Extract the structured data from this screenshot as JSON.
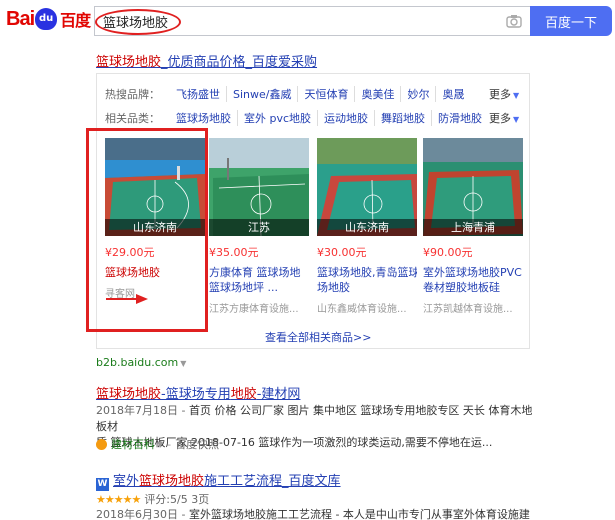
{
  "header": {
    "logo_bai": "Bai",
    "logo_du": "du",
    "logo_cn": "百度",
    "search_value": "篮球场地胶",
    "camera_icon": "camera-icon",
    "search_button": "百度一下",
    "brand_color": "#4e6ef2"
  },
  "ad": {
    "title_hl": "篮球场地胶",
    "title_rest": "_优质商品价格_百度爱采购",
    "brands_label": "热搜品牌：",
    "brands": [
      "飞扬盛世",
      "Sinwe/鑫威",
      "天恒体育",
      "奥美佳",
      "妙尔",
      "奥晟"
    ],
    "related_label": "相关品类：",
    "related": [
      "篮球场地胶",
      "室外 pvc地胶",
      "运动地胶",
      "舞蹈地胶",
      "防滑地胶"
    ],
    "more_label": "更多",
    "products": [
      {
        "location": "山东济南",
        "price": "¥29.00元",
        "name_line1_hl": "篮球场地胶",
        "name_line1_rest": "",
        "name_line2": "",
        "seller": "寻客网"
      },
      {
        "location": "江苏",
        "price": "¥35.00元",
        "name_line1_hl": "",
        "name_line1_rest": "方康体育 篮球场地",
        "name_line2": "篮球场地坪 ...",
        "seller": "江苏方康体育设施..."
      },
      {
        "location": "山东济南",
        "price": "¥30.00元",
        "name_line1_hl": "",
        "name_line1_rest": "篮球场地胶,青岛篮球",
        "name_line2": "场地胶",
        "seller": "山东鑫威体育设施..."
      },
      {
        "location": "上海青浦",
        "price": "¥90.00元",
        "name_line1_hl": "",
        "name_line1_rest": "室外篮球场地胶PVC",
        "name_line2": "卷材塑胶地板硅",
        "seller": "江苏凯越体育设施..."
      }
    ],
    "view_all": "查看全部相关商品>>",
    "source_url": "b2b.baidu.com"
  },
  "results": [
    {
      "title_parts": [
        {
          "t": "篮球场地胶",
          "hl": true
        },
        {
          "t": "-篮球场专用",
          "hl": false
        },
        {
          "t": "地胶",
          "hl": true
        },
        {
          "t": "-建材网",
          "hl": false
        }
      ],
      "snippet_date": "2018年7月18日 - ",
      "snippet_line1": "首页 价格 公司厂家 图片 集中地区 篮球场专用地胶专区 天长 体育木地板材",
      "snippet_line2": "质 篮球木地板厂家 2018-07-16 篮球作为一项激烈的球类运动,需要不停地在运...",
      "source": "建材百科",
      "snapshot": "百度快照"
    },
    {
      "title_parts": [
        {
          "t": "室外",
          "hl": false
        },
        {
          "t": "篮球场地胶",
          "hl": true
        },
        {
          "t": "施工工艺流程_百度文库",
          "hl": false
        }
      ],
      "doc_icon": "W",
      "rating_stars": "★★★★★",
      "rating_text": "评分:5/5 3页",
      "snippet_date": "2018年6月30日 - ",
      "snippet_line1": "室外篮球场地胶施工工艺流程 - 本人是中山市专门从事室外体育设施建设"
    }
  ],
  "annotations": {
    "frame_color": "#e02020",
    "arrow_icon": "red-arrow-icon"
  }
}
